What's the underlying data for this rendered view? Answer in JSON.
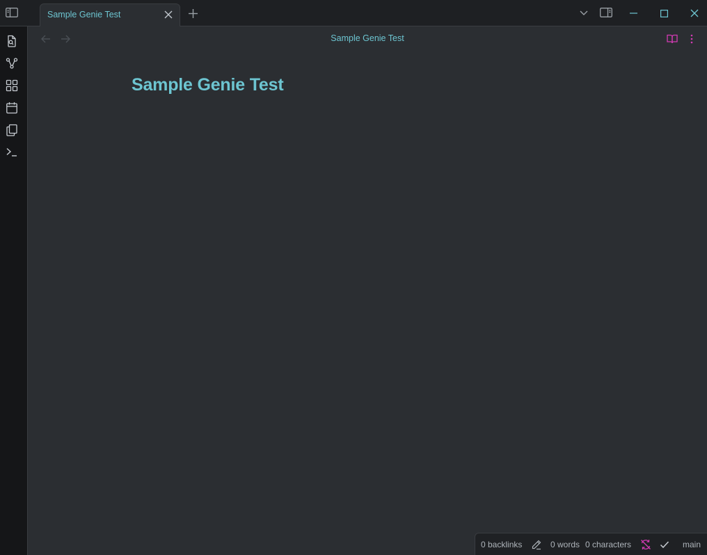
{
  "window": {
    "tab": {
      "label": "Sample Genie Test"
    },
    "icons": {
      "sidebar_toggle": "sidebar-toggle-icon",
      "tab_close": "close-icon",
      "new_tab": "plus-icon",
      "tab_list": "chevron-down-icon",
      "right_sidebar": "right-sidebar-icon",
      "minimize": "minimize-icon",
      "maximize": "maximize-icon",
      "close_window": "close-icon"
    }
  },
  "ribbon": {
    "items": [
      {
        "name": "open-quick-switcher",
        "icon": "file-search-icon"
      },
      {
        "name": "open-graph-view",
        "icon": "graph-icon"
      },
      {
        "name": "open-canvas",
        "icon": "layout-grid-icon"
      },
      {
        "name": "open-daily-note",
        "icon": "calendar-icon"
      },
      {
        "name": "insert-template",
        "icon": "copy-icon"
      },
      {
        "name": "open-command-palette",
        "icon": "terminal-icon"
      }
    ]
  },
  "view": {
    "header_title": "Sample Genie Test",
    "note_heading": "Sample Genie Test"
  },
  "statusbar": {
    "backlinks": "0 backlinks",
    "words": "0 words",
    "characters": "0 characters",
    "branch": "main"
  },
  "colors": {
    "accent": "#6dc5d1",
    "pink": "#d33bb4",
    "background": "#2b2e32",
    "titlebar": "#1e2023",
    "ribbon": "#151618"
  }
}
